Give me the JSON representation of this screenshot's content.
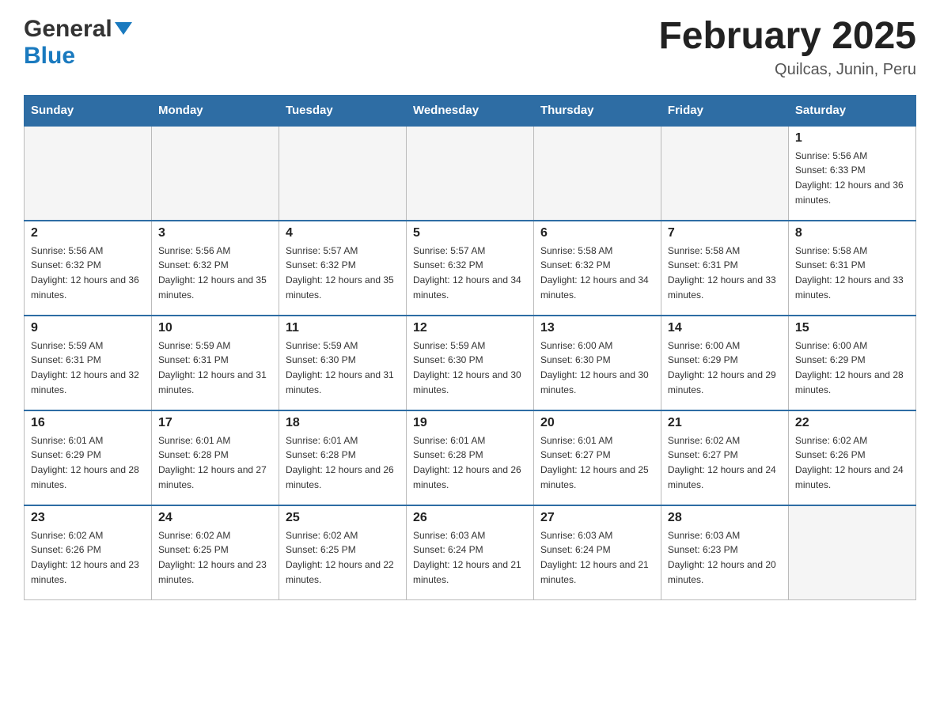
{
  "header": {
    "logo_line1": "General",
    "logo_line2": "Blue",
    "month_title": "February 2025",
    "location": "Quilcas, Junin, Peru"
  },
  "days_of_week": [
    "Sunday",
    "Monday",
    "Tuesday",
    "Wednesday",
    "Thursday",
    "Friday",
    "Saturday"
  ],
  "weeks": [
    [
      {
        "num": "",
        "info": ""
      },
      {
        "num": "",
        "info": ""
      },
      {
        "num": "",
        "info": ""
      },
      {
        "num": "",
        "info": ""
      },
      {
        "num": "",
        "info": ""
      },
      {
        "num": "",
        "info": ""
      },
      {
        "num": "1",
        "info": "Sunrise: 5:56 AM\nSunset: 6:33 PM\nDaylight: 12 hours and 36 minutes."
      }
    ],
    [
      {
        "num": "2",
        "info": "Sunrise: 5:56 AM\nSunset: 6:32 PM\nDaylight: 12 hours and 36 minutes."
      },
      {
        "num": "3",
        "info": "Sunrise: 5:56 AM\nSunset: 6:32 PM\nDaylight: 12 hours and 35 minutes."
      },
      {
        "num": "4",
        "info": "Sunrise: 5:57 AM\nSunset: 6:32 PM\nDaylight: 12 hours and 35 minutes."
      },
      {
        "num": "5",
        "info": "Sunrise: 5:57 AM\nSunset: 6:32 PM\nDaylight: 12 hours and 34 minutes."
      },
      {
        "num": "6",
        "info": "Sunrise: 5:58 AM\nSunset: 6:32 PM\nDaylight: 12 hours and 34 minutes."
      },
      {
        "num": "7",
        "info": "Sunrise: 5:58 AM\nSunset: 6:31 PM\nDaylight: 12 hours and 33 minutes."
      },
      {
        "num": "8",
        "info": "Sunrise: 5:58 AM\nSunset: 6:31 PM\nDaylight: 12 hours and 33 minutes."
      }
    ],
    [
      {
        "num": "9",
        "info": "Sunrise: 5:59 AM\nSunset: 6:31 PM\nDaylight: 12 hours and 32 minutes."
      },
      {
        "num": "10",
        "info": "Sunrise: 5:59 AM\nSunset: 6:31 PM\nDaylight: 12 hours and 31 minutes."
      },
      {
        "num": "11",
        "info": "Sunrise: 5:59 AM\nSunset: 6:30 PM\nDaylight: 12 hours and 31 minutes."
      },
      {
        "num": "12",
        "info": "Sunrise: 5:59 AM\nSunset: 6:30 PM\nDaylight: 12 hours and 30 minutes."
      },
      {
        "num": "13",
        "info": "Sunrise: 6:00 AM\nSunset: 6:30 PM\nDaylight: 12 hours and 30 minutes."
      },
      {
        "num": "14",
        "info": "Sunrise: 6:00 AM\nSunset: 6:29 PM\nDaylight: 12 hours and 29 minutes."
      },
      {
        "num": "15",
        "info": "Sunrise: 6:00 AM\nSunset: 6:29 PM\nDaylight: 12 hours and 28 minutes."
      }
    ],
    [
      {
        "num": "16",
        "info": "Sunrise: 6:01 AM\nSunset: 6:29 PM\nDaylight: 12 hours and 28 minutes."
      },
      {
        "num": "17",
        "info": "Sunrise: 6:01 AM\nSunset: 6:28 PM\nDaylight: 12 hours and 27 minutes."
      },
      {
        "num": "18",
        "info": "Sunrise: 6:01 AM\nSunset: 6:28 PM\nDaylight: 12 hours and 26 minutes."
      },
      {
        "num": "19",
        "info": "Sunrise: 6:01 AM\nSunset: 6:28 PM\nDaylight: 12 hours and 26 minutes."
      },
      {
        "num": "20",
        "info": "Sunrise: 6:01 AM\nSunset: 6:27 PM\nDaylight: 12 hours and 25 minutes."
      },
      {
        "num": "21",
        "info": "Sunrise: 6:02 AM\nSunset: 6:27 PM\nDaylight: 12 hours and 24 minutes."
      },
      {
        "num": "22",
        "info": "Sunrise: 6:02 AM\nSunset: 6:26 PM\nDaylight: 12 hours and 24 minutes."
      }
    ],
    [
      {
        "num": "23",
        "info": "Sunrise: 6:02 AM\nSunset: 6:26 PM\nDaylight: 12 hours and 23 minutes."
      },
      {
        "num": "24",
        "info": "Sunrise: 6:02 AM\nSunset: 6:25 PM\nDaylight: 12 hours and 23 minutes."
      },
      {
        "num": "25",
        "info": "Sunrise: 6:02 AM\nSunset: 6:25 PM\nDaylight: 12 hours and 22 minutes."
      },
      {
        "num": "26",
        "info": "Sunrise: 6:03 AM\nSunset: 6:24 PM\nDaylight: 12 hours and 21 minutes."
      },
      {
        "num": "27",
        "info": "Sunrise: 6:03 AM\nSunset: 6:24 PM\nDaylight: 12 hours and 21 minutes."
      },
      {
        "num": "28",
        "info": "Sunrise: 6:03 AM\nSunset: 6:23 PM\nDaylight: 12 hours and 20 minutes."
      },
      {
        "num": "",
        "info": ""
      }
    ]
  ]
}
